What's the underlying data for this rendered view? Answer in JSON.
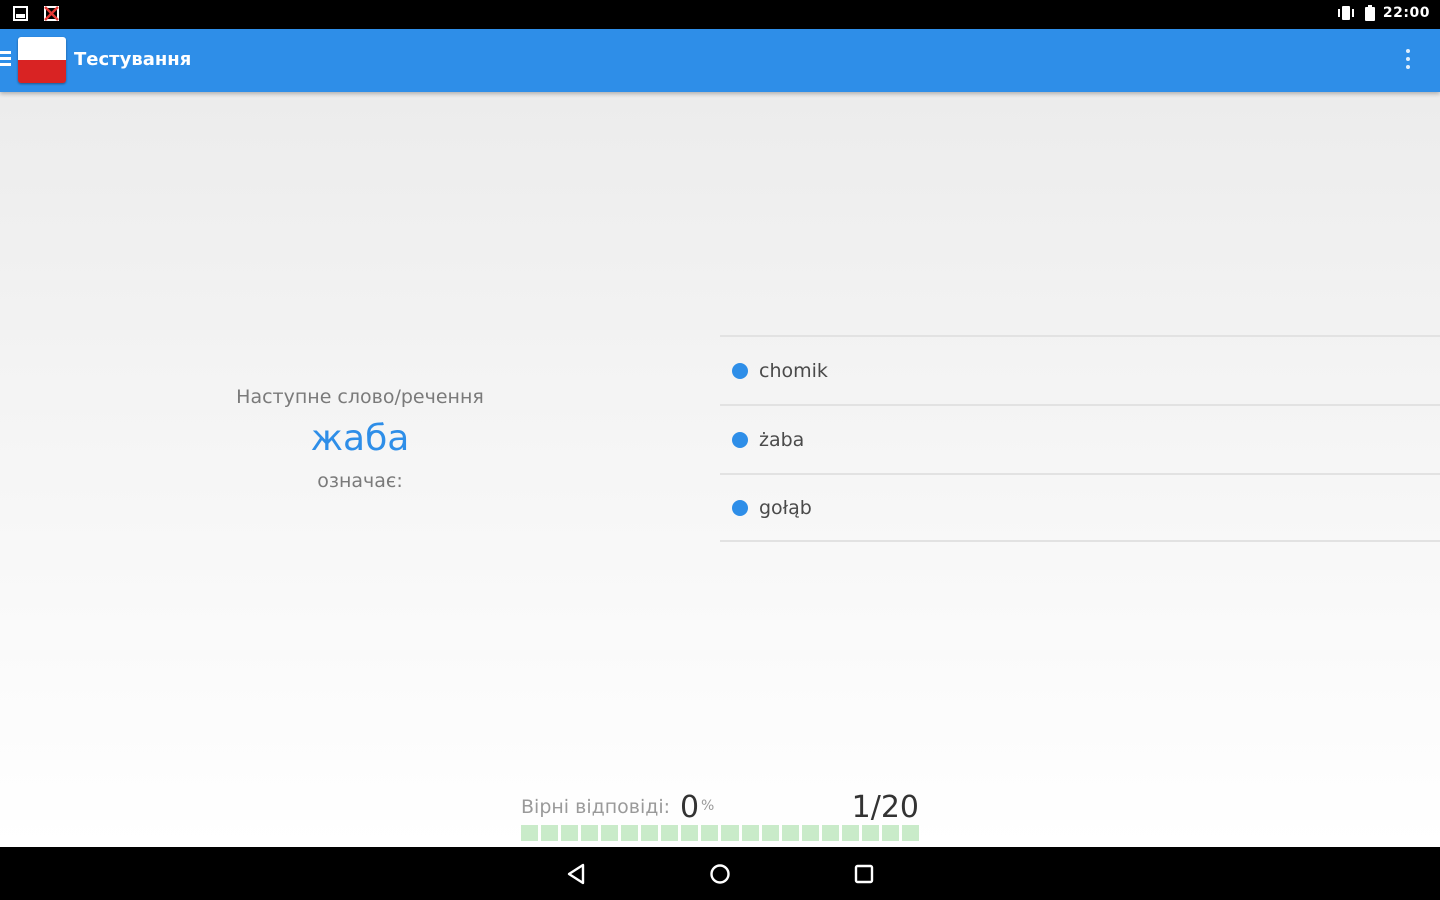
{
  "status_bar": {
    "time": "22:00",
    "icons": [
      "sd-card-icon",
      "no-sim-icon",
      "vibrate-icon",
      "battery-icon"
    ]
  },
  "app_bar": {
    "title": "Тестування",
    "icons": [
      "menu-icon",
      "poland-flag-icon",
      "overflow-menu-icon"
    ],
    "accent_color": "#2e8ee8"
  },
  "question": {
    "label": "Наступне слово/речення",
    "word": "жаба",
    "means": "означає:"
  },
  "answers": [
    {
      "text": "chomik"
    },
    {
      "text": "żaba"
    },
    {
      "text": "gołąb"
    }
  ],
  "progress": {
    "label": "Вірні відповіді:",
    "percent_value": "0",
    "percent_sign": "%",
    "count": "1/20",
    "segments_total": 20,
    "correct_fraction": 0
  },
  "nav_bar": {
    "icons": [
      "back-icon",
      "home-icon",
      "recent-apps-icon"
    ]
  }
}
